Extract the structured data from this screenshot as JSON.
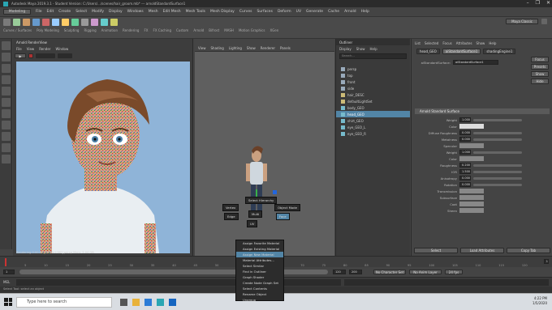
{
  "window": {
    "title": "Autodesk Maya 2019.3.1 - Student Version: C:/Users/.../scenes/hair_groom.mb* --- arnoldStandardSurface1",
    "buttons": [
      "–",
      "❐",
      "✕"
    ]
  },
  "menubar": {
    "items": [
      "File",
      "Edit",
      "Create",
      "Select",
      "Modify",
      "Display",
      "Windows",
      "Mesh",
      "Edit Mesh",
      "Mesh Tools",
      "Mesh Display",
      "Curves",
      "Surfaces",
      "Deform",
      "UV",
      "Generate",
      "Cache",
      "Arnold",
      "Help"
    ],
    "mode": "Modeling",
    "workspace": "Maya Classic"
  },
  "shelf": {
    "tabs": [
      "Curves / Surfaces",
      "Poly Modeling",
      "Sculpting",
      "Rigging",
      "Animation",
      "Rendering",
      "FX",
      "FX Caching",
      "Custom",
      "Arnold",
      "Bifrost",
      "MASH",
      "Motion Graphics",
      "XGen"
    ]
  },
  "renderview": {
    "title": "Arnold RenderView",
    "menu": [
      "File",
      "View",
      "Render",
      "Window"
    ],
    "status": "Rendering  0:00:12  [1920x1080]  persp  Mem: 2.04 GB"
  },
  "viewport": {
    "menu": [
      "View",
      "Shading",
      "Lighting",
      "Show",
      "Renderer",
      "Panels"
    ],
    "marking_menu": {
      "north": "Select Hierarchy",
      "west": "Vertex",
      "east": "Object Mode",
      "southwest": "Edge",
      "southeast": "Face",
      "south": "UV",
      "center": "Multi"
    },
    "popup_items": [
      "Assign Favorite Material",
      "Assign Existing Material",
      "Assign New Material",
      "Material Attributes...",
      "Select Similar",
      "Find in Outliner",
      "Graph Shader",
      "Create Node Graph Set",
      "Select Contents",
      "Rename Object",
      "Ungroup"
    ],
    "popup_highlight": 2
  },
  "outliner": {
    "title": "Outliner",
    "menu": [
      "Display",
      "Show",
      "Help"
    ],
    "search_placeholder": "Search...",
    "items": [
      {
        "label": "persp",
        "icon": "camera-icon",
        "selected": false
      },
      {
        "label": "top",
        "icon": "camera-icon",
        "selected": false
      },
      {
        "label": "front",
        "icon": "camera-icon",
        "selected": false
      },
      {
        "label": "side",
        "icon": "camera-icon",
        "selected": false
      },
      {
        "label": "hair_DESC",
        "icon": "group-icon",
        "selected": false
      },
      {
        "label": "defaultLightSet",
        "icon": "set-icon",
        "selected": false
      },
      {
        "label": "body_GEO",
        "icon": "mesh-icon",
        "selected": false
      },
      {
        "label": "head_GEO",
        "icon": "mesh-icon",
        "selected": true
      },
      {
        "label": "shirt_GEO",
        "icon": "mesh-icon",
        "selected": false
      },
      {
        "label": "eye_GEO_L",
        "icon": "mesh-icon",
        "selected": false
      },
      {
        "label": "eye_GEO_R",
        "icon": "mesh-icon",
        "selected": false
      }
    ]
  },
  "attribute_editor": {
    "menu": [
      "List",
      "Selected",
      "Focus",
      "Attributes",
      "Show",
      "Help"
    ],
    "tabs": [
      "head_GEO",
      "aiStandardSurface1",
      "shadingEngine1"
    ],
    "node_label": "aiStandardSurface:",
    "node_value": "aiStandardSurface1",
    "side_buttons": [
      "Focus",
      "Presets",
      "Show",
      "Hide"
    ],
    "section": "Arnold Standard Surface",
    "rows": [
      {
        "label": "Weight",
        "value": "1.000"
      },
      {
        "label": "Color",
        "value": ""
      },
      {
        "label": "Diffuse Roughness",
        "value": "0.000"
      },
      {
        "label": "Metalness",
        "value": "0.000"
      },
      {
        "label": "Specular",
        "value": ""
      },
      {
        "label": "Weight",
        "value": "1.000"
      },
      {
        "label": "Color",
        "value": ""
      },
      {
        "label": "Roughness",
        "value": "0.200"
      },
      {
        "label": "IOR",
        "value": "1.500"
      },
      {
        "label": "Anisotropy",
        "value": "0.000"
      },
      {
        "label": "Rotation",
        "value": "0.000"
      },
      {
        "label": "Transmission",
        "value": ""
      },
      {
        "label": "Subsurface",
        "value": ""
      },
      {
        "label": "Coat",
        "value": ""
      },
      {
        "label": "Sheen",
        "value": ""
      }
    ],
    "footer": [
      "Select",
      "Load Attributes",
      "Copy Tab"
    ],
    "notes": "Notes: aiStandardSurface1"
  },
  "timeline": {
    "ticks": [
      "1",
      "5",
      "10",
      "15",
      "20",
      "25",
      "30",
      "35",
      "40",
      "45",
      "50",
      "55",
      "60",
      "65",
      "70",
      "75",
      "80",
      "85",
      "90",
      "95",
      "100",
      "105",
      "110",
      "115",
      "120"
    ],
    "current": "1",
    "start": "1",
    "end": "120",
    "range_end": "200",
    "fps": "24 fps",
    "no_character": "No Character Set",
    "no_anim": "No Anim Layer"
  },
  "commandline": {
    "label": "MEL",
    "help": "Select Tool: select an object"
  },
  "taskbar": {
    "search_placeholder": "Type here to search",
    "time": "4:22 PM",
    "date": "1/5/2020"
  },
  "colors": {
    "accent": "#5285a6",
    "viewport_bg": "#5f5f5f",
    "render_bg": "#8fb4d8"
  }
}
